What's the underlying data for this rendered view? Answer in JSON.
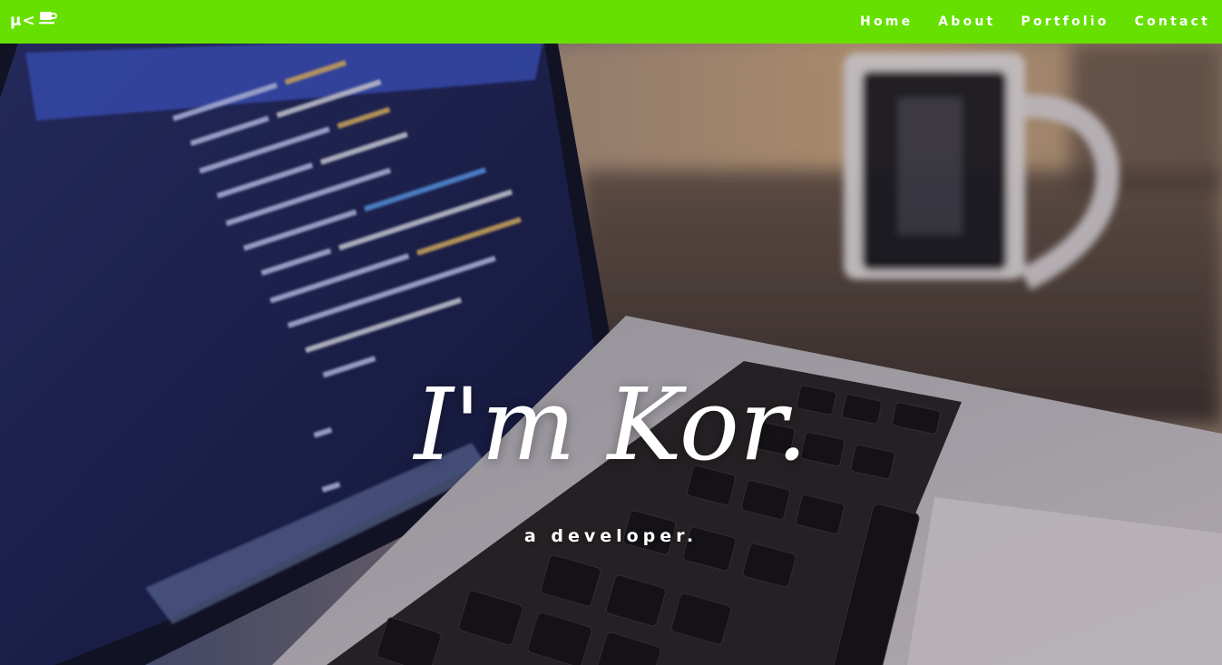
{
  "brand": {
    "text": "μ<",
    "icon": "coffee-cup-icon"
  },
  "nav": {
    "items": [
      {
        "label": "Home"
      },
      {
        "label": "About"
      },
      {
        "label": "Portfolio"
      },
      {
        "label": "Contact"
      }
    ]
  },
  "hero": {
    "title": "I'm Kor.",
    "subtitle": "a developer.",
    "background": "laptop-with-code-and-coffee-mug-photo"
  },
  "colors": {
    "navbar": "#66e000",
    "text": "#ffffff"
  }
}
